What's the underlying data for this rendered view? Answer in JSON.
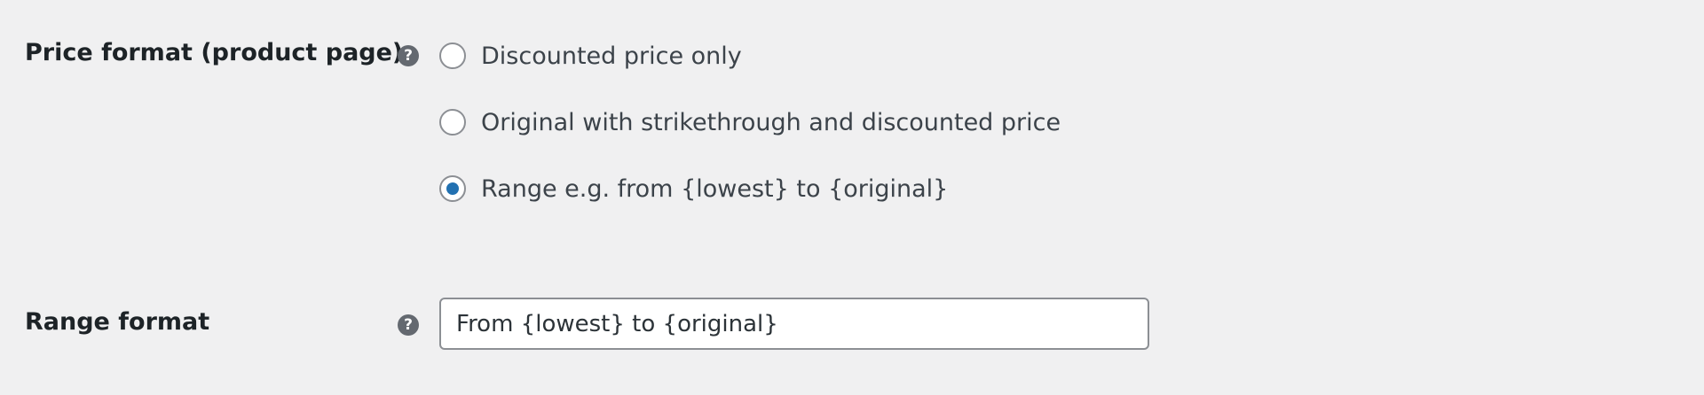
{
  "settings": {
    "price_format": {
      "label": "Price format (product page)",
      "help_icon": "question-mark-icon",
      "help_glyph": "?",
      "options": [
        {
          "label": "Discounted price only",
          "selected": false
        },
        {
          "label": "Original with strikethrough and discounted price",
          "selected": false
        },
        {
          "label": "Range e.g. from {lowest} to {original}",
          "selected": true
        }
      ]
    },
    "range_format": {
      "label": "Range format",
      "help_icon": "question-mark-icon",
      "help_glyph": "?",
      "value": "From {lowest} to {original}"
    }
  },
  "colors": {
    "background": "#f0f0f1",
    "accent": "#2271b1",
    "label_text": "#1d2327",
    "body_text": "#3c434a",
    "help_icon_bg": "#646970",
    "border": "#8c8f94"
  }
}
